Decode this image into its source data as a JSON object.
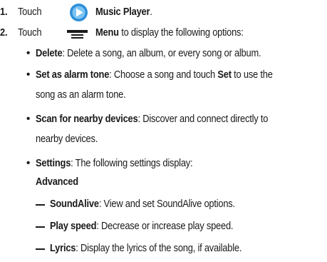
{
  "steps": [
    {
      "number": "1.",
      "prefix": "Touch",
      "icon": "music-player-icon",
      "target": "Music Player",
      "suffix": "."
    },
    {
      "number": "2.",
      "prefix": "Touch",
      "icon": "menu-icon",
      "target": "Menu",
      "suffix": "to display the following options:"
    }
  ],
  "options": [
    {
      "term": "Delete",
      "description": ": Delete a song, an album, or every song or album."
    },
    {
      "term": "Set as alarm tone",
      "description_line1_part1": ": Choose a song and touch",
      "description_line1_term": "Set",
      "description_line1_part2": "to use the",
      "description_line2": "song as an alarm tone."
    },
    {
      "term": "Scan for nearby devices",
      "description_line1": ": Discover and connect directly to",
      "description_line2": "nearby devices."
    },
    {
      "term": "Settings",
      "description": ": The following settings display:"
    }
  ],
  "advanced": {
    "heading": "Advanced",
    "items": [
      {
        "term": "SoundAlive",
        "description": ": View and set SoundAlive options."
      },
      {
        "term": "Play speed",
        "description": ": Decrease or increase play speed."
      },
      {
        "term": "Lyrics",
        "description": ": Display the lyrics of the song, if available."
      }
    ]
  },
  "colors": {
    "icon_blue": "#2f8fd8",
    "icon_dark": "#1a1a1a",
    "text": "#1a1a1a"
  }
}
